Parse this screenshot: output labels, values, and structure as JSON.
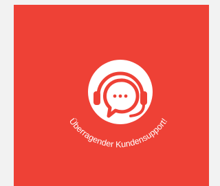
{
  "card": {
    "background_color": "#ee4136",
    "icon": "customer-support-headset-chat-icon",
    "icon_color": "#ffffff",
    "curved_text": "Überragender Kundensupport!",
    "text_color": "#ffffff"
  }
}
